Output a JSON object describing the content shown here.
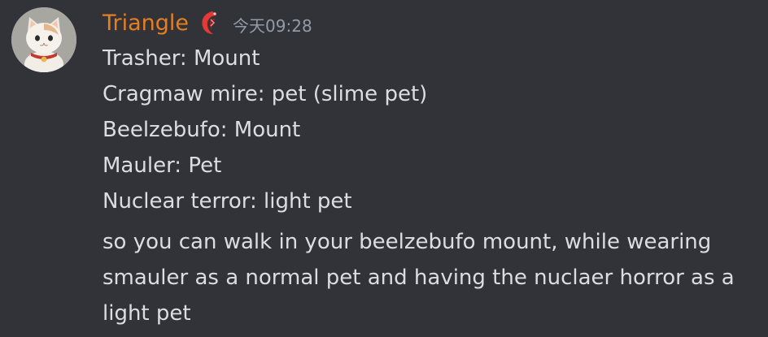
{
  "message": {
    "author": "Triangle",
    "timestamp": "今天09:28",
    "lines": [
      "Trasher: Mount",
      "Cragmaw mire: pet (slime pet)",
      "Beelzebufo: Mount",
      "Mauler: Pet",
      "Nuclear terror: light pet"
    ],
    "paragraph": "so you can walk in your beelzebufo mount, while wearing smauler as a normal pet and having the nuclaer horror as a light pet"
  },
  "icons": {
    "avatar": "cat-avatar",
    "role": "red-crest-icon"
  },
  "colors": {
    "background": "#313338",
    "username": "#e67e22",
    "text": "#dbdee1",
    "timestamp": "#949ba4"
  }
}
